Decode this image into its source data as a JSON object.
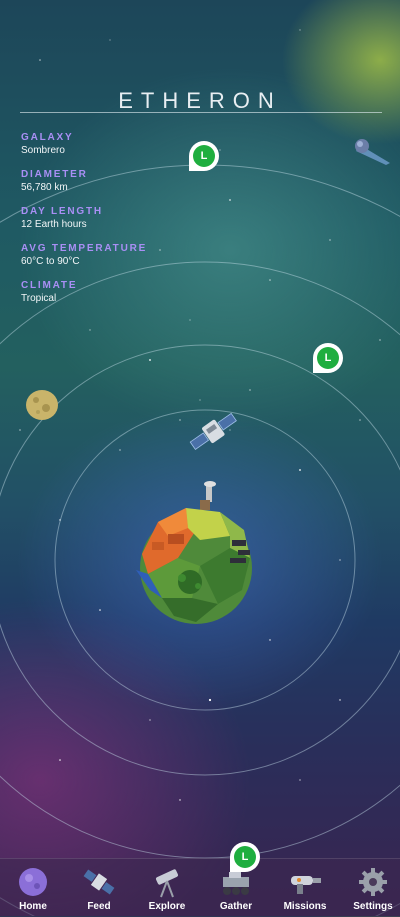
{
  "planet": {
    "name": "ETHERON"
  },
  "stats": [
    {
      "label": "GALAXY",
      "value": "Sombrero"
    },
    {
      "label": "DIAMETER",
      "value": "56,780 km"
    },
    {
      "label": "DAY LENGTH",
      "value": "12 Earth hours"
    },
    {
      "label": "AVG TEMPERATURE",
      "value": "60°C to 90°C"
    },
    {
      "label": "CLIMATE",
      "value": "Tropical"
    }
  ],
  "markers": [
    {
      "letter": "L"
    },
    {
      "letter": "L"
    },
    {
      "letter": "L"
    }
  ],
  "nav": [
    {
      "label": "Home",
      "icon": "planet-icon"
    },
    {
      "label": "Feed",
      "icon": "satellite-icon"
    },
    {
      "label": "Explore",
      "icon": "telescope-icon"
    },
    {
      "label": "Gather",
      "icon": "rover-icon"
    },
    {
      "label": "Missions",
      "icon": "raygun-icon"
    },
    {
      "label": "Settings",
      "icon": "gear-icon"
    }
  ],
  "colors": {
    "stat_label": "#a98ff5",
    "marker_green": "#1fae3f"
  }
}
